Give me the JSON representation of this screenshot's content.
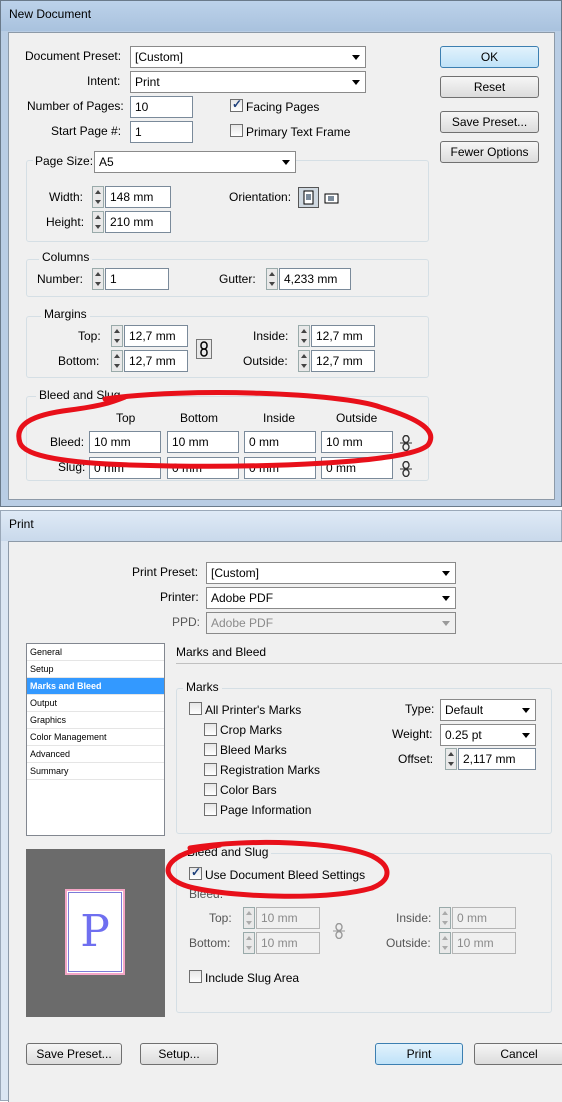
{
  "newdoc": {
    "title": "New Document",
    "preset_label": "Document Preset:",
    "preset_value": "[Custom]",
    "intent_label": "Intent:",
    "intent_value": "Print",
    "pages_label": "Number of Pages:",
    "pages_value": "10",
    "start_label": "Start Page #:",
    "start_value": "1",
    "facing_label": "Facing Pages",
    "facing_checked": true,
    "primary_label": "Primary Text Frame",
    "primary_checked": false,
    "ok": "OK",
    "reset": "Reset",
    "save_preset": "Save Preset...",
    "fewer": "Fewer Options",
    "page_size_label": "Page Size:",
    "page_size_value": "A5",
    "width_label": "Width:",
    "width_value": "148 mm",
    "height_label": "Height:",
    "height_value": "210 mm",
    "orientation_label": "Orientation:",
    "columns_title": "Columns",
    "number_label": "Number:",
    "number_value": "1",
    "gutter_label": "Gutter:",
    "gutter_value": "4,233 mm",
    "margins_title": "Margins",
    "top_label": "Top:",
    "top_value": "12,7 mm",
    "bottom_label": "Bottom:",
    "bottom_value": "12,7 mm",
    "inside_label": "Inside:",
    "inside_value": "12,7 mm",
    "outside_label": "Outside:",
    "outside_value": "12,7 mm",
    "bleed_title": "Bleed and Slug",
    "col_top": "Top",
    "col_bottom": "Bottom",
    "col_inside": "Inside",
    "col_outside": "Outside",
    "bleed_label": "Bleed:",
    "bleed_values": [
      "10 mm",
      "10 mm",
      "0 mm",
      "10 mm"
    ],
    "slug_label": "Slug:",
    "slug_values": [
      "0 mm",
      "0 mm",
      "0 mm",
      "0 mm"
    ]
  },
  "print": {
    "title": "Print",
    "preset_label": "Print Preset:",
    "preset_value": "[Custom]",
    "printer_label": "Printer:",
    "printer_value": "Adobe PDF",
    "ppd_label": "PPD:",
    "ppd_value": "Adobe PDF",
    "nav": [
      "General",
      "Setup",
      "Marks and Bleed",
      "Output",
      "Graphics",
      "Color Management",
      "Advanced",
      "Summary"
    ],
    "section_title": "Marks and Bleed",
    "marks_title": "Marks",
    "all_marks": "All Printer's Marks",
    "crop": "Crop Marks",
    "bleed_marks": "Bleed Marks",
    "registration": "Registration Marks",
    "color_bars": "Color Bars",
    "page_info": "Page Information",
    "type_label": "Type:",
    "type_value": "Default",
    "weight_label": "Weight:",
    "weight_value": "0.25 pt",
    "offset_label": "Offset:",
    "offset_value": "2,117 mm",
    "bs_title": "Bleed and Slug",
    "use_doc": "Use Document Bleed Settings",
    "bleed_sub": "Bleed:",
    "top_label": "Top:",
    "top_value": "10 mm",
    "bottom_label": "Bottom:",
    "bottom_value": "10 mm",
    "inside_label": "Inside:",
    "inside_value": "0 mm",
    "outside_label": "Outside:",
    "outside_value": "10 mm",
    "include_slug": "Include Slug Area",
    "preview_letter": "P",
    "save_preset": "Save Preset...",
    "setup": "Setup...",
    "print_btn": "Print",
    "cancel": "Cancel"
  },
  "colors": {
    "annotation_red": "#e8101a",
    "selection_blue": "#3399ff",
    "titlebar": "#b3cbe5"
  }
}
